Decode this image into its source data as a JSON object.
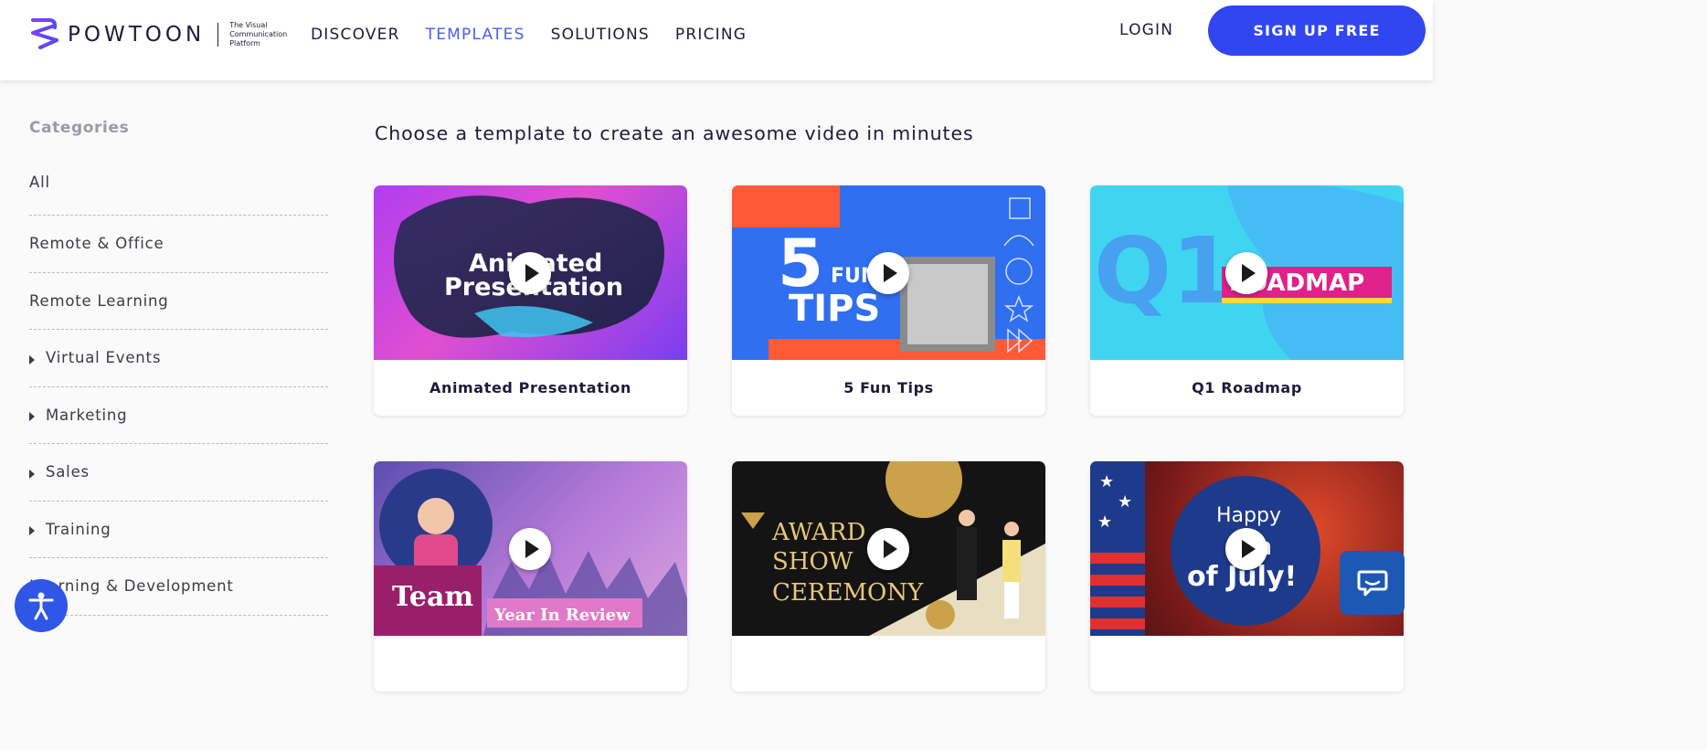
{
  "header": {
    "brand": "POWTOON",
    "tagline": "The Visual Communication Platform",
    "nav": [
      "DISCOVER",
      "TEMPLATES",
      "SOLUTIONS",
      "PRICING"
    ],
    "active_nav": "TEMPLATES",
    "login": "LOGIN",
    "signup": "SIGN UP FREE"
  },
  "sidebar": {
    "title": "Categories",
    "items": [
      {
        "label": "All",
        "expandable": false
      },
      {
        "label": "Remote & Office",
        "expandable": false
      },
      {
        "label": "Remote Learning",
        "expandable": false
      },
      {
        "label": "Virtual Events",
        "expandable": true
      },
      {
        "label": "Marketing",
        "expandable": true
      },
      {
        "label": "Sales",
        "expandable": true
      },
      {
        "label": "Training",
        "expandable": true
      },
      {
        "label": "Learning & Development",
        "expandable": false
      }
    ]
  },
  "main": {
    "heading": "Choose a template to create an awesome video in minutes",
    "templates": [
      {
        "label": "Animated Presentation",
        "thumb_text": [
          "Animated",
          "Presentation"
        ]
      },
      {
        "label": "5 Fun Tips",
        "thumb_text": [
          "5",
          "FUN",
          "TIPS"
        ]
      },
      {
        "label": "Q1 Roadmap",
        "thumb_text": [
          "Q1",
          "ROADMAP"
        ]
      },
      {
        "label": "",
        "thumb_text": [
          "Team",
          "Year In Review"
        ]
      },
      {
        "label": "",
        "thumb_text": [
          "AWARD",
          "SHOW",
          "CEREMONY"
        ]
      },
      {
        "label": "",
        "thumb_text": [
          "Happy",
          "4th",
          "of July!"
        ]
      }
    ]
  },
  "colors": {
    "accent": "#3046f0",
    "active_nav": "#4a5fe8",
    "chat": "#1d58b5",
    "accessibility": "#2f56e6"
  },
  "icons": [
    "powtoon-logo-icon",
    "play-icon",
    "accessibility-icon",
    "chat-icon",
    "caret-right-icon"
  ]
}
